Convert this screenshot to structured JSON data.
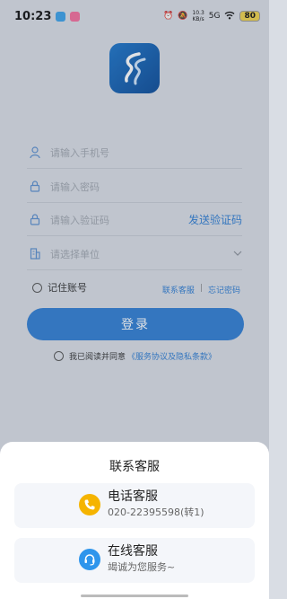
{
  "status_bar": {
    "time": "10:23",
    "net_speed_value": "10.3",
    "net_speed_unit": "KB/s",
    "signal": "5G",
    "battery": "80"
  },
  "login": {
    "phone_placeholder": "请输入手机号",
    "password_placeholder": "请输入密码",
    "code_placeholder": "请输入验证码",
    "send_code": "发送验证码",
    "unit_placeholder": "请选择单位",
    "remember_label": "记住账号",
    "contact_link": "联系客服",
    "link_separator": "|",
    "forgot_link": "忘记密码",
    "login_button": "登录",
    "agree_prefix": "我已阅读并同意",
    "agree_policy": "《服务协议及隐私条款》"
  },
  "sheet": {
    "title": "联系客服",
    "options": [
      {
        "title": "电话客服",
        "subtitle": "020-22395598(转1)",
        "icon": "phone-icon",
        "color": "#f5b400"
      },
      {
        "title": "在线客服",
        "subtitle": "竭诚为您服务~",
        "icon": "headset-icon",
        "color": "#2e95ec"
      }
    ]
  },
  "colors": {
    "accent": "#2f7dd2",
    "logo": "#1560b0"
  }
}
